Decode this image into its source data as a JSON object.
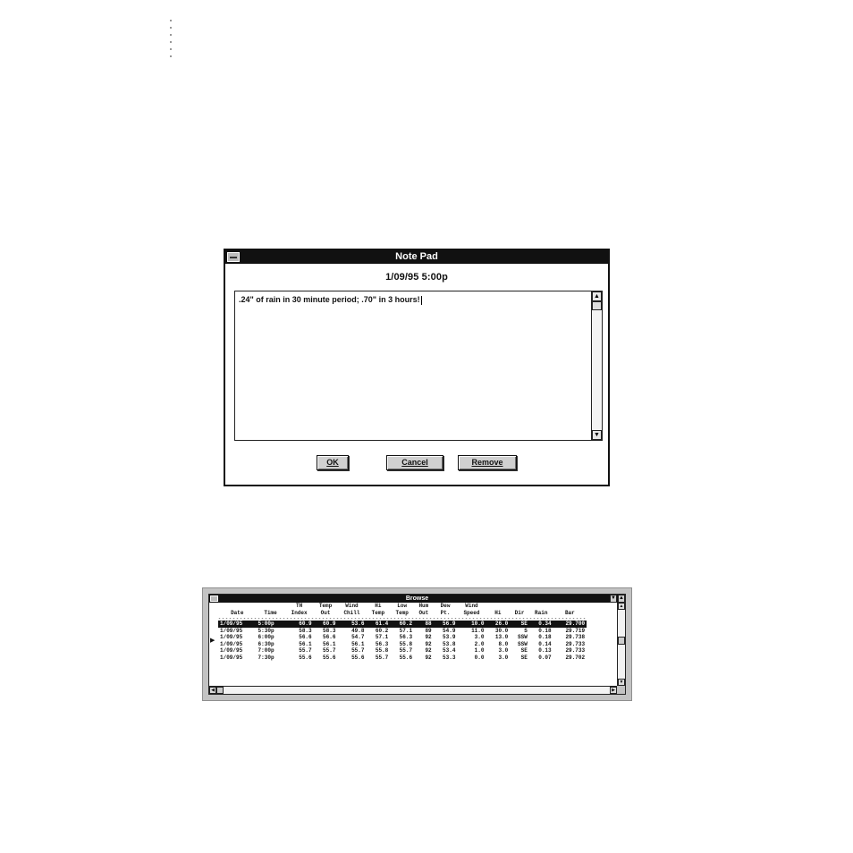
{
  "notepad": {
    "title": "Note Pad",
    "date_time": "1/09/95  5:00p",
    "note_text": ".24\" of rain in 30 minute period; .70\" in 3 hours!",
    "buttons": {
      "ok": "OK",
      "cancel": "Cancel",
      "remove": "Remove"
    }
  },
  "browse": {
    "title": "Browse",
    "headers": [
      [
        "",
        "Date"
      ],
      [
        "",
        "Time"
      ],
      [
        "TH",
        "Index"
      ],
      [
        "Temp",
        "Out"
      ],
      [
        "Wind",
        "Chill"
      ],
      [
        "Hi",
        "Temp"
      ],
      [
        "Low",
        "Temp"
      ],
      [
        "Hum",
        "Out"
      ],
      [
        "Dew",
        "Pt."
      ],
      [
        "Wind",
        "Speed"
      ],
      [
        "",
        "Hi"
      ],
      [
        "",
        "Dir"
      ],
      [
        "",
        "Rain"
      ],
      [
        "",
        "Bar"
      ]
    ],
    "separator": "-------------------------------------------------------------------------------------------------------",
    "selected_row_index": 0,
    "rows": [
      [
        "1/09/95",
        "5:00p",
        "60.9",
        "60.9",
        "53.6",
        "61.4",
        "60.2",
        "88",
        "56.9",
        "10.0",
        "26.0",
        "SE",
        "0.34",
        "29.700"
      ],
      [
        "1/09/95",
        "5:30p",
        "58.3",
        "58.3",
        "49.8",
        "60.2",
        "57.1",
        "89",
        "54.9",
        "11.0",
        "30.0",
        "S",
        "0.18",
        "29.719"
      ],
      [
        "1/09/95",
        "6:00p",
        "56.6",
        "56.6",
        "54.7",
        "57.1",
        "56.3",
        "92",
        "53.9",
        "3.0",
        "13.0",
        "SSW",
        "0.18",
        "29.738"
      ],
      [
        "1/09/95",
        "6:30p",
        "56.1",
        "56.1",
        "56.1",
        "56.3",
        "55.8",
        "92",
        "53.8",
        "2.0",
        "8.0",
        "SSW",
        "0.14",
        "29.733"
      ],
      [
        "1/09/95",
        "7:00p",
        "55.7",
        "55.7",
        "55.7",
        "55.8",
        "55.7",
        "92",
        "53.4",
        "1.0",
        "3.0",
        "SE",
        "0.13",
        "29.733"
      ],
      [
        "1/09/95",
        "7:30p",
        "55.6",
        "55.6",
        "55.6",
        "55.7",
        "55.6",
        "92",
        "53.3",
        "0.0",
        "3.0",
        "SE",
        "0.07",
        "29.702"
      ]
    ]
  }
}
